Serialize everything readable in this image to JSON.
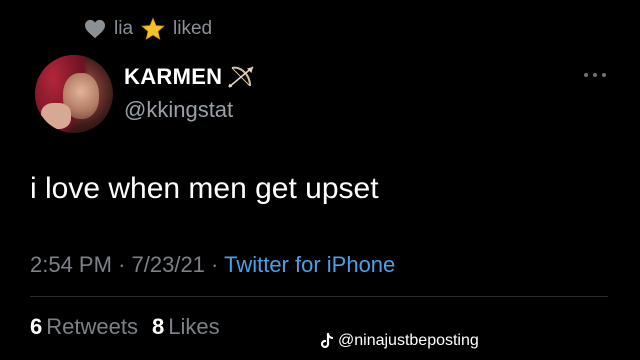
{
  "context": {
    "liker": "lia",
    "action": "liked",
    "heart_icon": "heart-icon",
    "star_icon": "star-icon"
  },
  "tweet": {
    "display_name": "KARMEN",
    "handle": "@kkingstat",
    "text": "i love when men get upset",
    "time": "2:54 PM",
    "date": "7/23/21",
    "source": "Twitter for iPhone",
    "retweets_count": "6",
    "retweets_label": "Retweets",
    "likes_count": "8",
    "likes_label": "Likes"
  },
  "watermark": {
    "text": "@ninajustbeposting"
  },
  "colors": {
    "background": "#000000",
    "link": "#4aa0e8",
    "muted": "#7c8188"
  }
}
